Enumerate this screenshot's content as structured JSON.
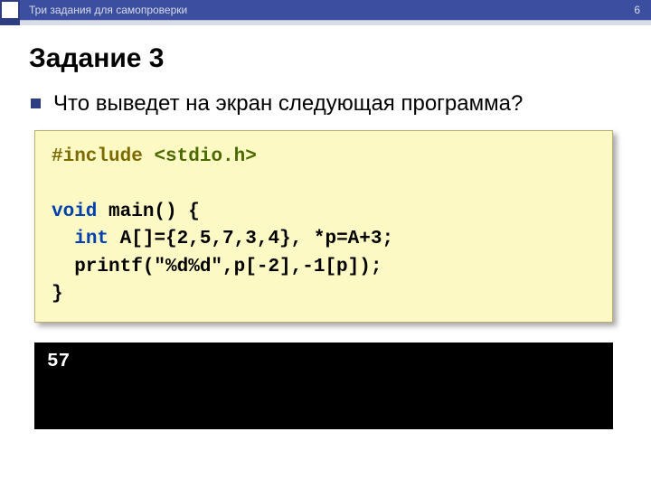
{
  "header": {
    "breadcrumb": "Три задания для самопроверки",
    "page_number": "6"
  },
  "title": "Задание 3",
  "question": "Что выведет на экран следующая программа?",
  "code": {
    "include_kw": "#include",
    "include_hdr": "<stdio.h>",
    "void_kw": "void",
    "main_sig": " main() {",
    "int_kw": "int",
    "decl_rest": " A[]={2,5,7,3,4}, *p=A+3;",
    "printf_line": "  printf(\"%d%d\",p[-2],-1[p]);",
    "close_brace": "}"
  },
  "output": "57"
}
